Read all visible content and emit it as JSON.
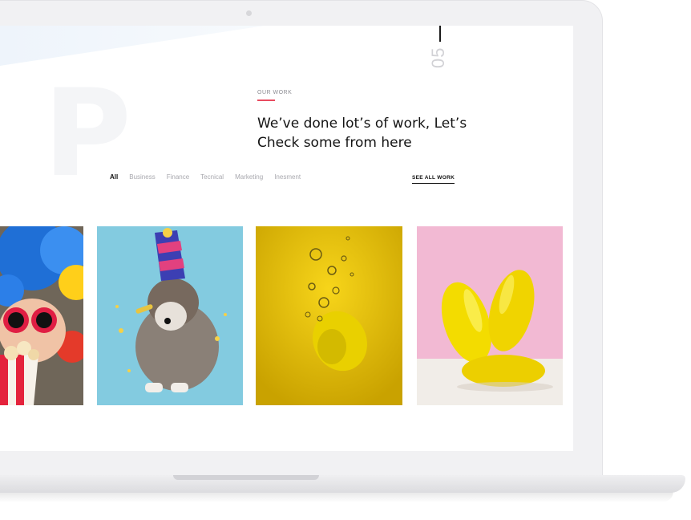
{
  "page": {
    "number": "05",
    "decor_letter": "P"
  },
  "section": {
    "eyebrow": "OUR WORK",
    "headline_line1": "We’ve done lot’s of work, Let’s",
    "headline_line2": "Check some from here",
    "accent_color": "#e84b5f"
  },
  "filters": {
    "tabs": [
      {
        "label": "All",
        "active": true
      },
      {
        "label": "Business"
      },
      {
        "label": "Finance"
      },
      {
        "label": "Tecnical"
      },
      {
        "label": "Marketing"
      },
      {
        "label": "Inesment"
      }
    ],
    "see_all_label": "SEE ALL WORK"
  },
  "portfolio": {
    "items": [
      {
        "subject": "clown-wig-popcorn",
        "bg": "#6d6355"
      },
      {
        "subject": "party-dog",
        "bg": "#7fc7dd"
      },
      {
        "subject": "lemon-splash",
        "bg": "#f2c600"
      },
      {
        "subject": "yellow-balloon",
        "bg": "#f1b9d5"
      }
    ]
  }
}
